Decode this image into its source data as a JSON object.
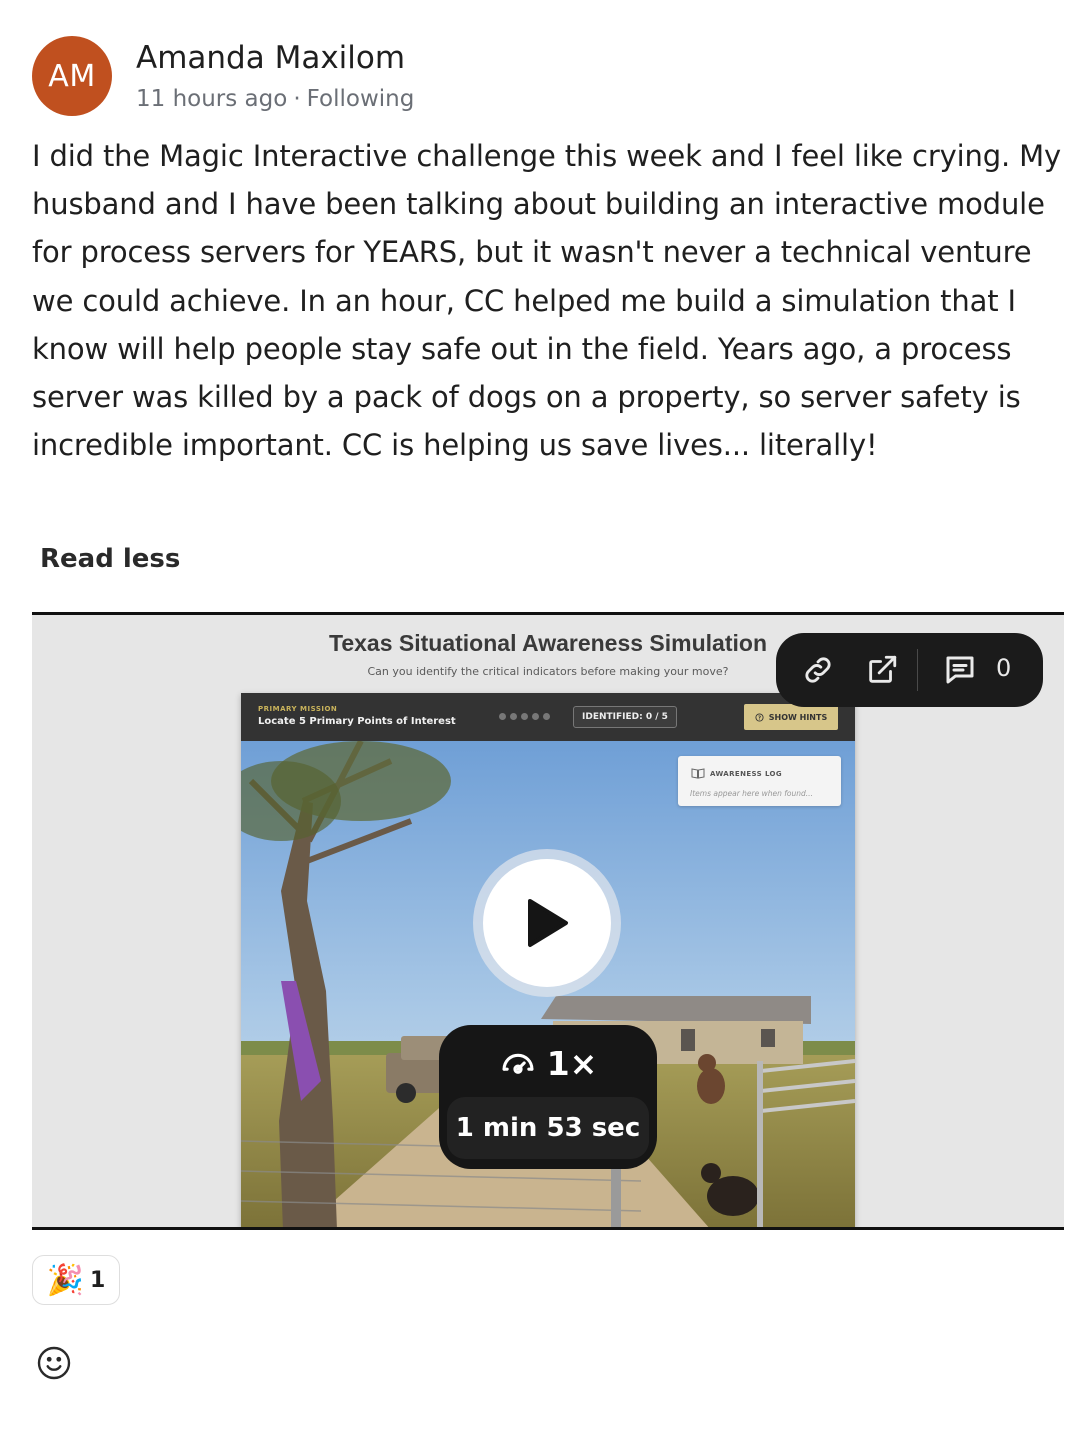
{
  "author": {
    "initials": "AM",
    "name": "Amanda Maxilom",
    "time": "11 hours ago",
    "separator": "·",
    "follow_status": "Following",
    "avatar_color": "#c0501f"
  },
  "post": {
    "body": "I did the Magic Interactive challenge this week and I feel like crying. My husband and I have been talking about building an interactive module for process servers for YEARS, but it wasn't never a technical venture we could achieve. In an hour, CC helped me build a simulation that I know will help people stay safe out in the field. Years ago, a process server was killed by a pack of dogs on a property, so server safety is incredible important. CC is helping us save lives... literally!",
    "read_less": "Read less"
  },
  "video": {
    "sim_title": "Texas Situational Awareness Simulation",
    "sim_subtitle": "Can you identify the critical indicators before making your move?",
    "mission_label": "PRIMARY MISSION",
    "mission_text": "Locate 5 Primary Points of Interest",
    "identified": "IDENTIFIED: 0 / 5",
    "hints": "SHOW HINTS",
    "awareness_title": "AWARENESS LOG",
    "awareness_sub": "Items appear here when found...",
    "toolbar": {
      "icons": [
        "link-icon",
        "external-link-icon",
        "comment-icon"
      ],
      "comment_count": "0"
    },
    "speed": "1×",
    "duration": "1 min 53 sec"
  },
  "reactions": {
    "emoji": "🎉",
    "count": "1",
    "add_icon": "smiley-icon"
  }
}
